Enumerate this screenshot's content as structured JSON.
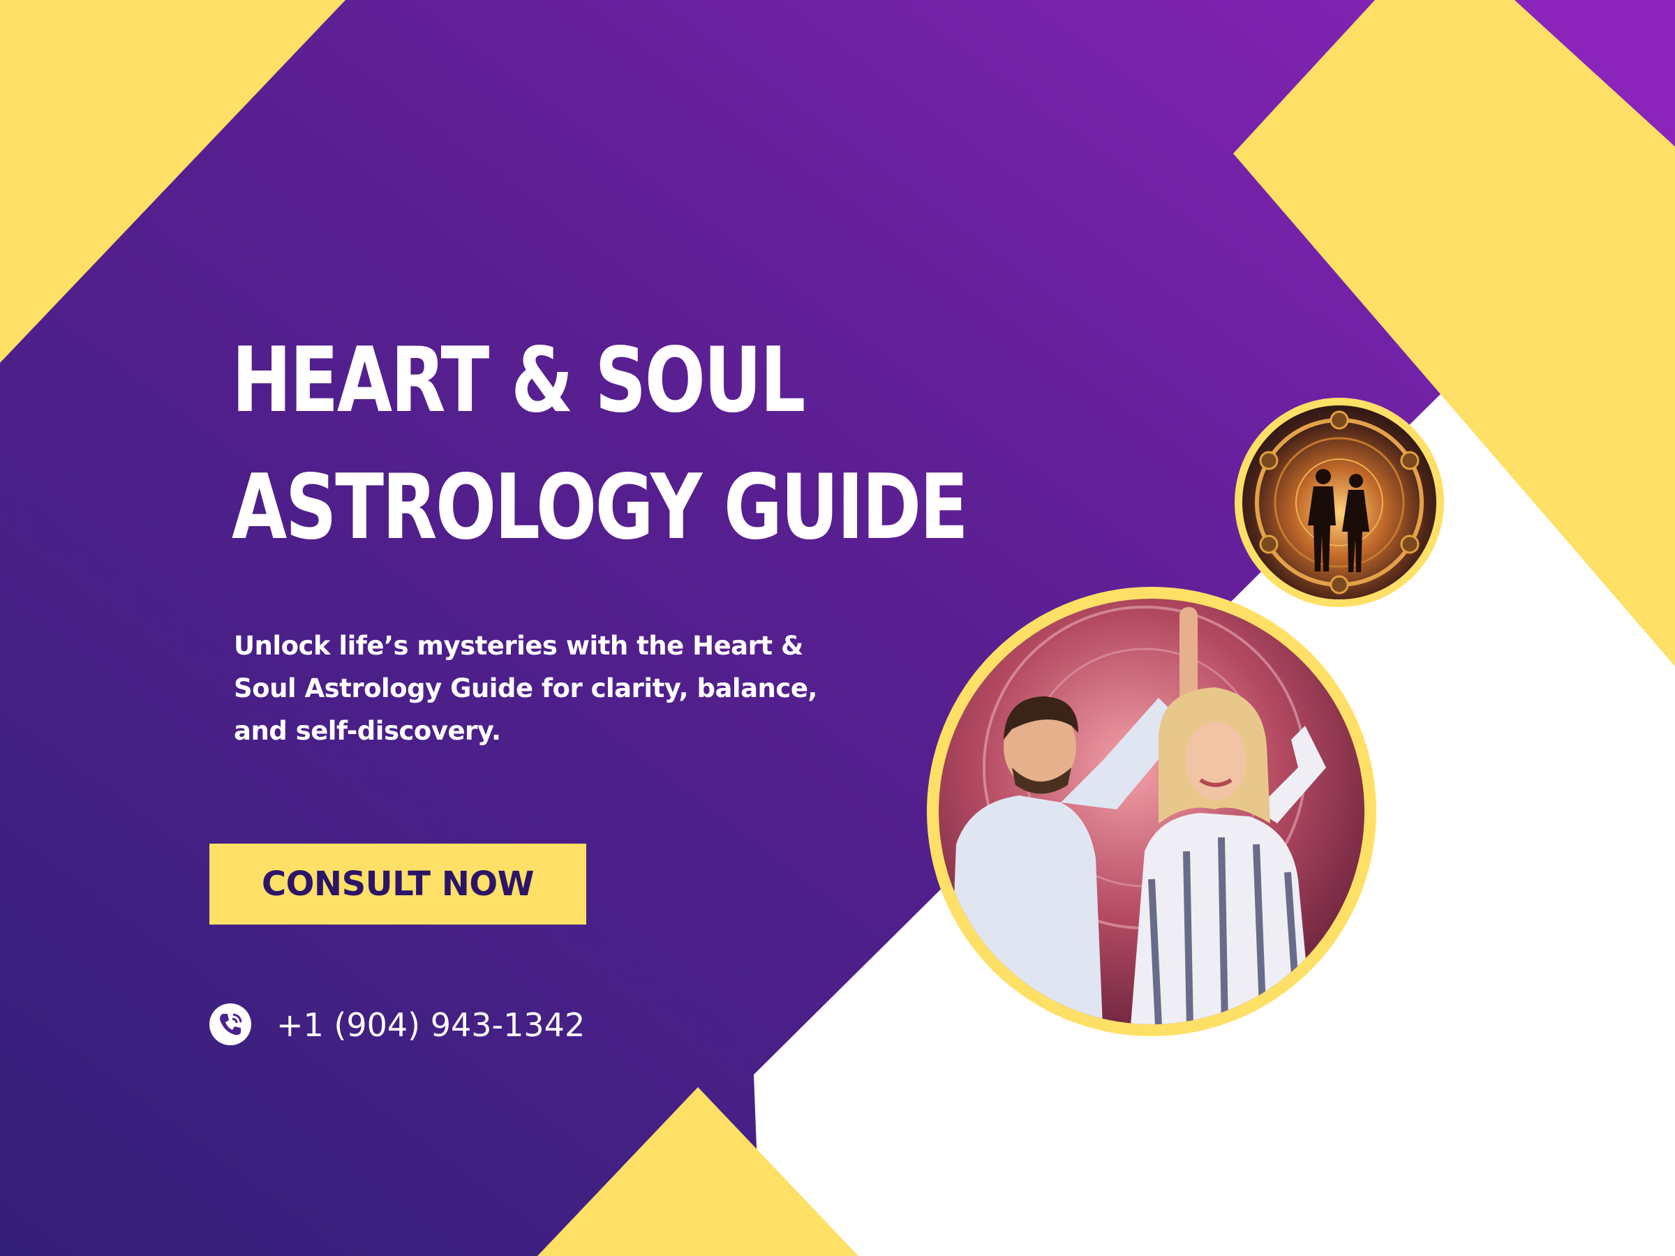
{
  "headline": {
    "line1": "HEART & SOUL",
    "line2": "ASTROLOGY GUIDE"
  },
  "tagline": {
    "line1": "Unlock life’s mysteries with the Heart &",
    "line2": "Soul Astrology Guide for clarity, balance,",
    "line3": "and self-discovery."
  },
  "cta": {
    "label": "CONSULT NOW"
  },
  "contact": {
    "phone": "+1 (904) 943-1342",
    "icon": "phone-icon"
  },
  "imagery": {
    "small_circle": "zodiac-wheel-couple-silhouette",
    "large_circle": "couple-dancing-photo"
  },
  "colors": {
    "purple_dark": "#3a1d7a",
    "purple_light": "#8a25b8",
    "yellow": "#ffe066",
    "button_text": "#2c1468",
    "white": "#ffffff"
  }
}
